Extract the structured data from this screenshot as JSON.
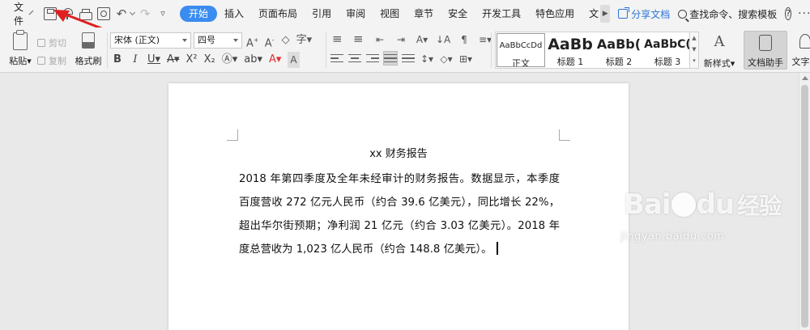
{
  "menu": {
    "file_label": "文件"
  },
  "tabs": [
    {
      "label": "开始",
      "active": true
    },
    {
      "label": "插入"
    },
    {
      "label": "页面布局"
    },
    {
      "label": "引用"
    },
    {
      "label": "审阅"
    },
    {
      "label": "视图"
    },
    {
      "label": "章节"
    },
    {
      "label": "安全"
    },
    {
      "label": "开发工具"
    },
    {
      "label": "特色应用"
    },
    {
      "label": "文"
    }
  ],
  "actions": {
    "share_label": "分享文档",
    "search_label": "查找命令、搜索模板",
    "help_label": "?",
    "more_label": "···"
  },
  "clipboard": {
    "paste_label": "粘贴",
    "cut_label": "剪切",
    "copy_label": "复制",
    "format_painter_label": "格式刷"
  },
  "font": {
    "family": "宋体 (正文)",
    "size": "四号"
  },
  "styles": [
    {
      "sample": "AaBbCcDd",
      "name": "正文"
    },
    {
      "sample": "AaBb",
      "name": "标题 1"
    },
    {
      "sample": "AaBb(",
      "name": "标题 2"
    },
    {
      "sample": "AaBbC(",
      "name": "标题 3"
    }
  ],
  "tools": {
    "new_style_label": "新样式",
    "doc_helper_label": "文档助手",
    "text_tool_label": "文字工"
  },
  "document": {
    "title": "xx 财务报告",
    "body": "2018 年第四季度及全年未经审计的财务报告。数据显示，本季度百度营收 272 亿元人民币（约合 39.6 亿美元），同比增长 22%，超出华尔街预期；净利润 21 亿元（约合 3.03 亿美元）。2018 年度总营收为 1,023 亿人民币（约合 148.8 亿美元）。"
  },
  "watermark": {
    "brand": "Bai",
    "brand_tail": "du",
    "cn": "经验",
    "url": "jingyan.baidu.com"
  },
  "colors": {
    "accent": "#3a8cf0",
    "share": "#2a74d8",
    "annotation": "#e02020"
  }
}
